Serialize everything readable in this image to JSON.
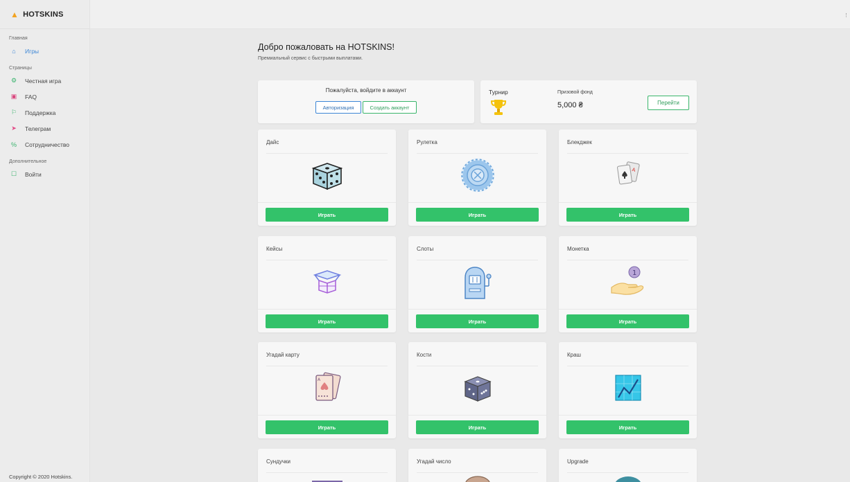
{
  "brand": {
    "name": "HOTSKINS"
  },
  "sidebar": {
    "sections": [
      {
        "label": "Главная",
        "items": [
          {
            "label": "Игры",
            "icon": "home-icon",
            "active": true
          }
        ]
      },
      {
        "label": "Страницы",
        "items": [
          {
            "label": "Честная игра",
            "icon": "gear-icon"
          },
          {
            "label": "FAQ",
            "icon": "book-icon"
          },
          {
            "label": "Поддержка",
            "icon": "flag-icon"
          },
          {
            "label": "Телеграм",
            "icon": "telegram-icon"
          },
          {
            "label": "Сотрудничество",
            "icon": "percent-icon"
          }
        ]
      },
      {
        "label": "Дополнительное",
        "items": [
          {
            "label": "Войти",
            "icon": "lock-icon"
          }
        ]
      }
    ],
    "copyright": "Copyright © 2020 Hotskins."
  },
  "main": {
    "title": "Добро пожаловать на HOTSKINS!",
    "subtitle": "Премиальный сервис с быстрыми выплатами."
  },
  "login": {
    "text": "Пожалуйста, войдите в аккаунт",
    "auth_label": "Авторизация",
    "create_label": "Создать аккаунт"
  },
  "tournament": {
    "title": "Турнир",
    "prize_label": "Призовой фонд",
    "prize_value": "5,000 ₴",
    "go_label": "Перейти"
  },
  "play_label": "Играть",
  "games": [
    {
      "name": "Дайс",
      "icon": "dice-icon"
    },
    {
      "name": "Рулетка",
      "icon": "roulette-icon"
    },
    {
      "name": "Блекджек",
      "icon": "cards-icon"
    },
    {
      "name": "Кейсы",
      "icon": "box-icon"
    },
    {
      "name": "Слоты",
      "icon": "slot-machine-icon"
    },
    {
      "name": "Монетка",
      "icon": "coin-hand-icon"
    },
    {
      "name": "Угадай карту",
      "icon": "playing-card-icon"
    },
    {
      "name": "Кости",
      "icon": "bones-icon"
    },
    {
      "name": "Краш",
      "icon": "crash-chart-icon"
    },
    {
      "name": "Сундучки",
      "icon": "chest-icon"
    },
    {
      "name": "Угадай число",
      "icon": "number-icon"
    },
    {
      "name": "Upgrade",
      "icon": "upgrade-icon"
    }
  ],
  "colors": {
    "accent_blue": "#3c86d6",
    "accent_green": "#33c26a",
    "brand_flame": "#f2a322"
  }
}
